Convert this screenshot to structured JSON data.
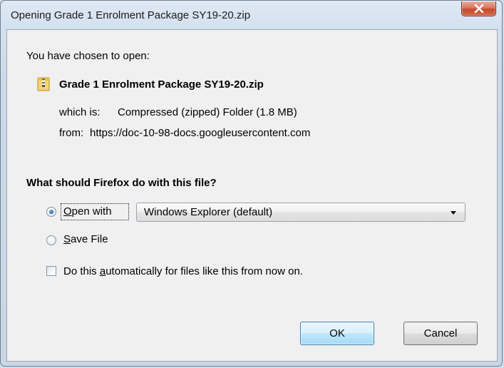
{
  "window": {
    "title": "Opening Grade 1 Enrolment Package SY19-20.zip"
  },
  "dialog": {
    "intro": "You have chosen to open:",
    "file_icon": "zip-folder-icon",
    "filename": "Grade 1 Enrolment Package SY19-20.zip",
    "which_is_label": "which is:",
    "which_is_value": "Compressed (zipped) Folder (1.8 MB)",
    "from_label": "from:",
    "from_value": "https://doc-10-98-docs.googleusercontent.com",
    "question": "What should Firefox do with this file?",
    "open_with": {
      "label_access": "O",
      "label_rest": "pen with",
      "selected": true,
      "app_selected": "Windows Explorer (default)"
    },
    "save_file": {
      "label_access": "S",
      "label_rest": "ave File",
      "selected": false
    },
    "auto": {
      "label_pre": "Do this ",
      "label_access": "a",
      "label_rest": "utomatically for files like this from now on.",
      "checked": false
    }
  },
  "buttons": {
    "ok": "OK",
    "cancel": "Cancel"
  },
  "colors": {
    "accent_radio": "#2a66b6",
    "close_button": "#c44a2b",
    "default_button_border": "#3c7fb1"
  }
}
